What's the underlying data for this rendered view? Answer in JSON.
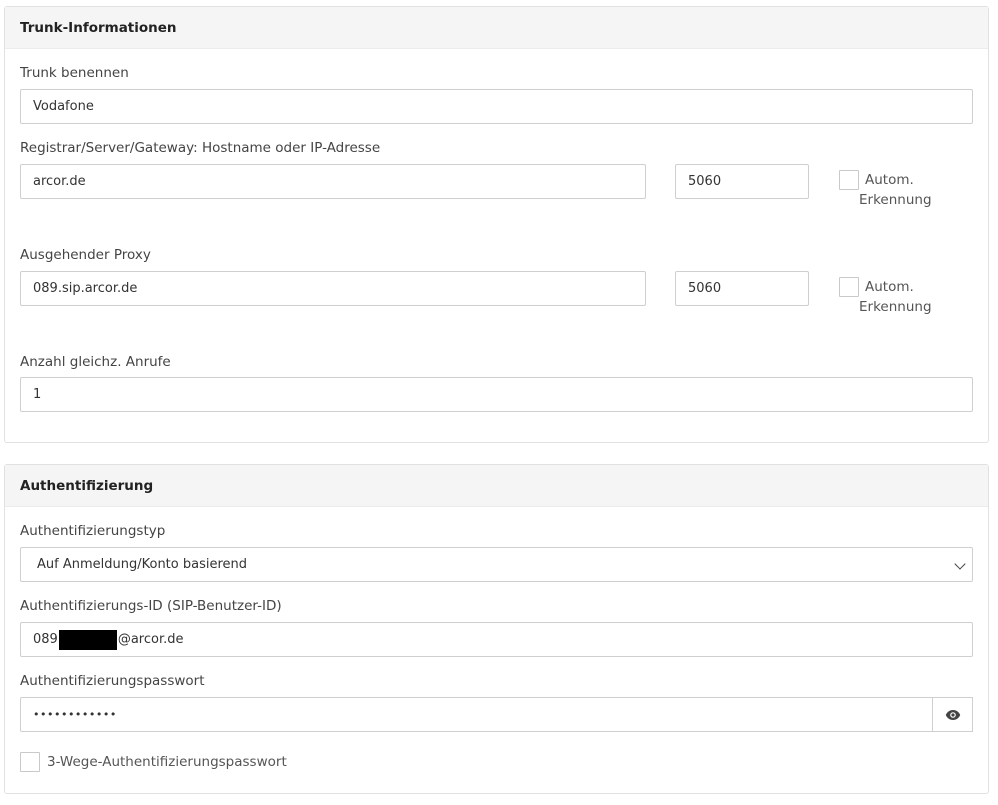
{
  "trunk": {
    "title": "Trunk-Informationen",
    "name_label": "Trunk benennen",
    "name_value": "Vodafone",
    "registrar_label": "Registrar/Server/Gateway: Hostname oder IP-Adresse",
    "registrar_host": "arcor.de",
    "registrar_port": "5060",
    "auto_detect_line1": "Autom.",
    "auto_detect_line2": "Erkennung",
    "proxy_label": "Ausgehender Proxy",
    "proxy_host": "089.sip.arcor.de",
    "proxy_port": "5060",
    "calls_label": "Anzahl gleichz. Anrufe",
    "calls_value": "1"
  },
  "auth": {
    "title": "Authentifizierung",
    "type_label": "Authentifizierungstyp",
    "type_value": "Auf Anmeldung/Konto basierend",
    "id_label": "Authentifizierungs-ID (SIP-Benutzer-ID)",
    "id_prefix": "089",
    "id_suffix": "@arcor.de",
    "password_label": "Authentifizierungspasswort",
    "password_value": "••••••••••••",
    "three_way_label": "3-Wege-Authentifizierungspasswort"
  },
  "icons": {
    "select_caret": "chevron-down-icon",
    "show_password": "eye-icon"
  }
}
